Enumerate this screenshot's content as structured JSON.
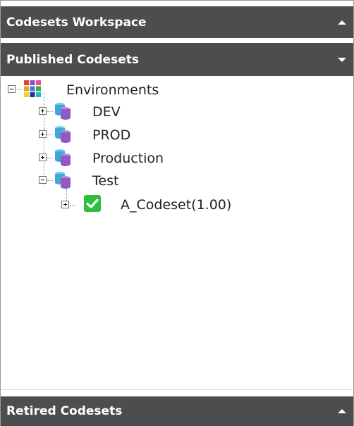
{
  "headers": {
    "workspace": {
      "label": "Codesets Workspace",
      "arrow": "collapse-arrow-up-icon"
    },
    "published": {
      "label": "Published Codesets",
      "arrow": "expand-arrow-down-icon"
    },
    "retired": {
      "label": "Retired Codesets",
      "arrow": "collapse-arrow-up-icon"
    }
  },
  "tree": {
    "root": {
      "label": "Environments",
      "icon": "environments-grid-icon",
      "expanded": true
    },
    "children": [
      {
        "label": "DEV",
        "icon": "database-stack-icon",
        "expanded": false
      },
      {
        "label": "PROD",
        "icon": "database-stack-icon",
        "expanded": false
      },
      {
        "label": "Production",
        "icon": "database-stack-icon",
        "expanded": false
      },
      {
        "label": "Test",
        "icon": "database-stack-icon",
        "expanded": true,
        "children": [
          {
            "label": "A_Codeset(1.00)",
            "icon": "published-check-icon",
            "expanded": false
          }
        ]
      }
    ]
  },
  "colors": {
    "header_bg": "#4d4d4f",
    "header_text": "#ffffff",
    "check_green": "#2dbe3c"
  }
}
